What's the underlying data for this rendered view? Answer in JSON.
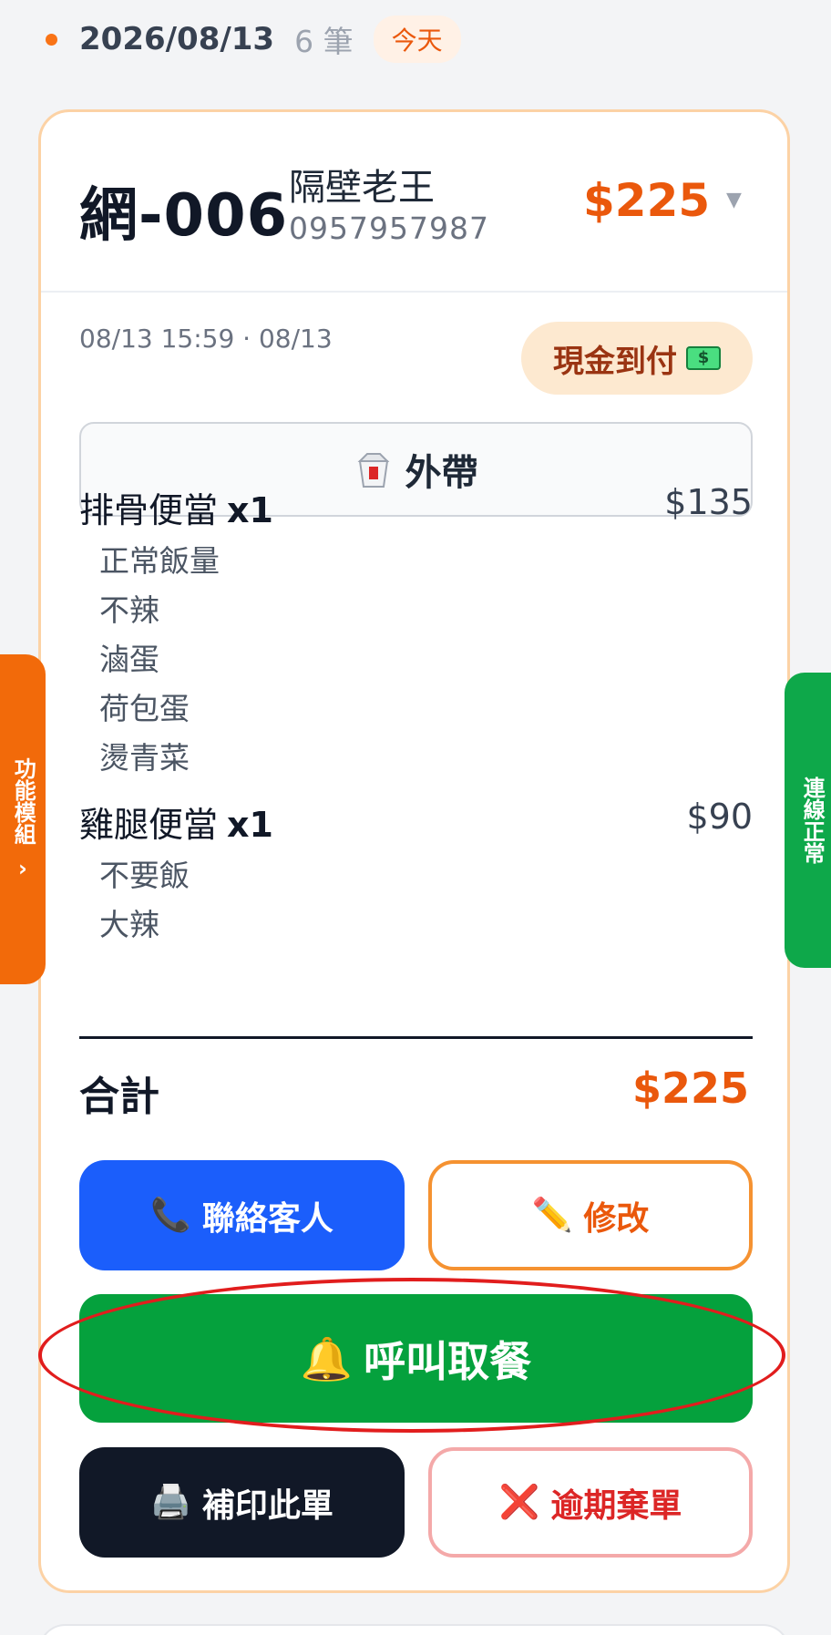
{
  "date_header": {
    "date": "2026/08/13",
    "count": "6 筆",
    "today_badge": "今天"
  },
  "order": {
    "number": "網-006",
    "customer_name": "隔壁老王",
    "customer_phone": "0957957987",
    "header_total": "$225",
    "time": "08/13 15:59 · 08/13",
    "payment_method": "現金到付",
    "service_mode": "外帶",
    "items": [
      {
        "name": "排骨便當",
        "qty": "x1",
        "price": "$135",
        "options": [
          "正常飯量",
          "不辣",
          "滷蛋",
          "荷包蛋",
          "燙青菜"
        ]
      },
      {
        "name": "雞腿便當",
        "qty": "x1",
        "price": "$90",
        "options": [
          "不要飯",
          "大辣"
        ]
      }
    ],
    "total_label": "合計",
    "total_value": "$225"
  },
  "actions": {
    "contact": "聯絡客人",
    "edit": "修改",
    "call_pickup": "呼叫取餐",
    "reprint": "補印此單",
    "void_overdue": "逾期棄單"
  },
  "side_tabs": {
    "left": "功能模組",
    "right": "連線正常"
  },
  "colors": {
    "accent_orange": "#ea580c",
    "contact_blue": "#1b5efb",
    "call_green": "#05a13d",
    "print_dark": "#111827",
    "void_red": "#dc2626"
  }
}
